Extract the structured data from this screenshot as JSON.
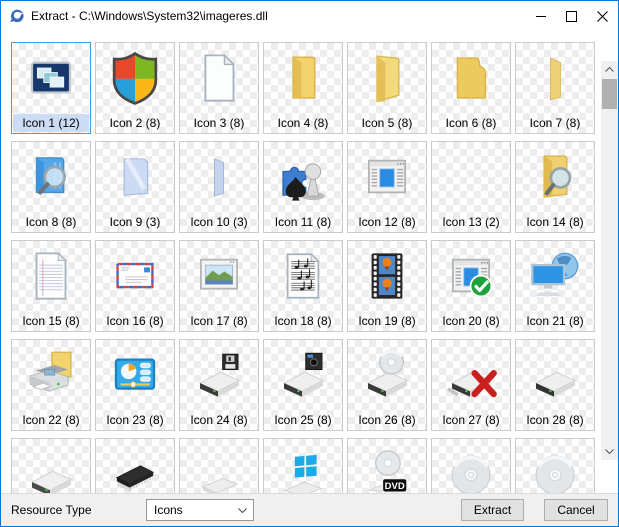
{
  "window": {
    "title": "Extract - C:\\Windows\\System32\\imageres.dll",
    "icons": [
      "app-logo-icon",
      "minimize-icon",
      "maximize-icon",
      "close-icon"
    ]
  },
  "grid": {
    "items": [
      {
        "label": "Icon 1 (12)",
        "type": "taskbar-windows",
        "selected": true
      },
      {
        "label": "Icon 2 (8)",
        "type": "security-shield",
        "selected": false
      },
      {
        "label": "Icon 3 (8)",
        "type": "blank-document",
        "selected": false
      },
      {
        "label": "Icon 4 (8)",
        "type": "folder-closed",
        "selected": false
      },
      {
        "label": "Icon 5 (8)",
        "type": "folder-open",
        "selected": false
      },
      {
        "label": "Icon 6 (8)",
        "type": "folder-front",
        "selected": false
      },
      {
        "label": "Icon 7 (8)",
        "type": "folder-side",
        "selected": false
      },
      {
        "label": "Icon 8 (8)",
        "type": "search-folder-blue",
        "selected": false
      },
      {
        "label": "Icon 9 (3)",
        "type": "folder-translucent",
        "selected": false
      },
      {
        "label": "Icon 10 (3)",
        "type": "folder-translucent-side",
        "selected": false
      },
      {
        "label": "Icon 11 (8)",
        "type": "games",
        "selected": false
      },
      {
        "label": "Icon 12 (8)",
        "type": "app-window",
        "selected": false
      },
      {
        "label": "Icon 13 (2)",
        "type": "empty",
        "selected": false
      },
      {
        "label": "Icon 14 (8)",
        "type": "search-folder-yellow",
        "selected": false
      },
      {
        "label": "Icon 15 (8)",
        "type": "text-document",
        "selected": false
      },
      {
        "label": "Icon 16 (8)",
        "type": "airmail-envelope",
        "selected": false
      },
      {
        "label": "Icon 17 (8)",
        "type": "picture-window",
        "selected": false
      },
      {
        "label": "Icon 18 (8)",
        "type": "sheet-music",
        "selected": false
      },
      {
        "label": "Icon 19 (8)",
        "type": "film-strip",
        "selected": false
      },
      {
        "label": "Icon 20 (8)",
        "type": "app-window-check",
        "selected": false
      },
      {
        "label": "Icon 21 (8)",
        "type": "computer-globe",
        "selected": false
      },
      {
        "label": "Icon 22 (8)",
        "type": "printer-folder",
        "selected": false
      },
      {
        "label": "Icon 23 (8)",
        "type": "control-panel",
        "selected": false
      },
      {
        "label": "Icon 24 (8)",
        "type": "floppy-drive",
        "selected": false
      },
      {
        "label": "Icon 25 (8)",
        "type": "floppy525-drive",
        "selected": false
      },
      {
        "label": "Icon 26 (8)",
        "type": "cd-drive",
        "selected": false
      },
      {
        "label": "Icon 27 (8)",
        "type": "drive-error",
        "selected": false
      },
      {
        "label": "Icon 28 (8)",
        "type": "hard-drive",
        "selected": false
      },
      {
        "label": null,
        "type": "external-drive",
        "selected": false
      },
      {
        "label": null,
        "type": "memory-chip",
        "selected": false
      },
      {
        "label": null,
        "type": "flat-drive",
        "selected": false
      },
      {
        "label": null,
        "type": "windows-drive",
        "selected": false
      },
      {
        "label": null,
        "type": "dvd-drive",
        "selected": false
      },
      {
        "label": null,
        "type": "cd-disc",
        "selected": false
      },
      {
        "label": null,
        "type": "cd-disc",
        "selected": false
      }
    ]
  },
  "footer": {
    "resource_type_label": "Resource Type",
    "type_select_value": "Icons",
    "extract_button": "Extract",
    "cancel_button": "Cancel"
  },
  "colors": {
    "window_accent_border": "#0078d7",
    "selection_border": "#3d9ddd",
    "selection_label_bg": "#cbdcf4",
    "footer_bg": "#f0f0f0",
    "button_bg": "#e1e1e1",
    "button_border": "#adadad"
  }
}
